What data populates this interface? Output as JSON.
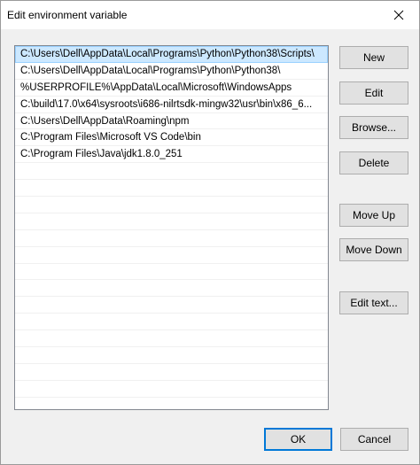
{
  "dialog": {
    "title": "Edit environment variable"
  },
  "paths": {
    "items": [
      {
        "text": "C:\\Users\\Dell\\AppData\\Local\\Programs\\Python\\Python38\\Scripts\\",
        "selected": true
      },
      {
        "text": "C:\\Users\\Dell\\AppData\\Local\\Programs\\Python\\Python38\\",
        "selected": false
      },
      {
        "text": "%USERPROFILE%\\AppData\\Local\\Microsoft\\WindowsApps",
        "selected": false
      },
      {
        "text": "C:\\build\\17.0\\x64\\sysroots\\i686-nilrtsdk-mingw32\\usr\\bin\\x86_6...",
        "selected": false
      },
      {
        "text": "C:\\Users\\Dell\\AppData\\Roaming\\npm",
        "selected": false
      },
      {
        "text": "C:\\Program Files\\Microsoft VS Code\\bin",
        "selected": false
      },
      {
        "text": "C:\\Program Files\\Java\\jdk1.8.0_251",
        "selected": false
      }
    ]
  },
  "buttons": {
    "new": "New",
    "edit": "Edit",
    "browse": "Browse...",
    "delete": "Delete",
    "move_up": "Move Up",
    "move_down": "Move Down",
    "edit_text": "Edit text...",
    "ok": "OK",
    "cancel": "Cancel"
  },
  "colors": {
    "selection": "#cce8ff",
    "default_button_border": "#0078d7",
    "button_face": "#e1e1e1",
    "window_background": "#f0f0f0"
  }
}
